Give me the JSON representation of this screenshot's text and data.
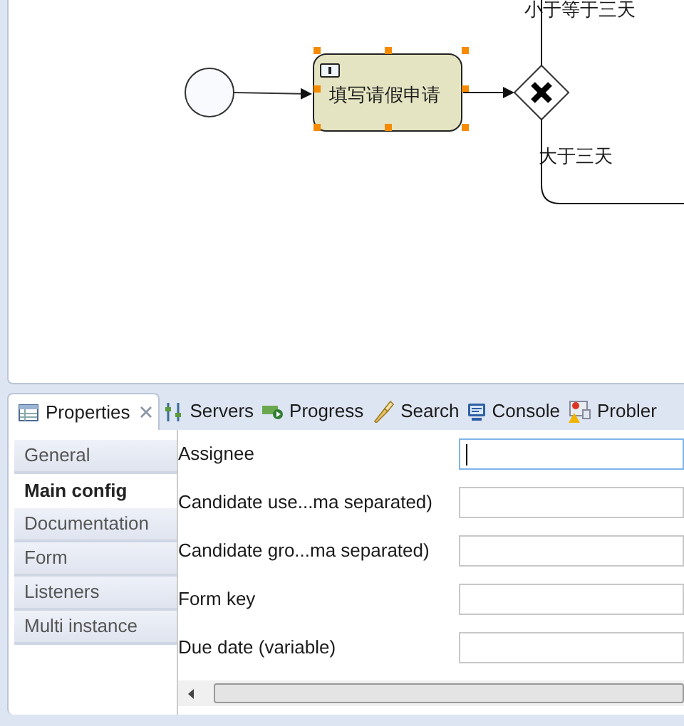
{
  "diagram": {
    "task": {
      "label": "填写请假申请",
      "selected": true
    },
    "flow_labels": [
      "小于等于三天",
      "大于三天"
    ]
  },
  "tabs": [
    {
      "label": "Properties",
      "selected": true,
      "closable": true
    },
    {
      "label": "Servers",
      "selected": false,
      "closable": false
    },
    {
      "label": "Progress",
      "selected": false,
      "closable": false
    },
    {
      "label": "Search",
      "selected": false,
      "closable": false
    },
    {
      "label": "Console",
      "selected": false,
      "closable": false
    },
    {
      "label": "Probler",
      "selected": false,
      "closable": false
    }
  ],
  "sections": [
    {
      "label": "General",
      "selected": false
    },
    {
      "label": "Main config",
      "selected": true
    },
    {
      "label": "Documentation",
      "selected": false
    },
    {
      "label": "Form",
      "selected": false
    },
    {
      "label": "Listeners",
      "selected": false
    },
    {
      "label": "Multi instance",
      "selected": false
    }
  ],
  "fields": [
    {
      "label": "Assignee",
      "focused": true
    },
    {
      "label": "Candidate use...ma separated)",
      "focused": false
    },
    {
      "label": "Candidate gro...ma separated)",
      "focused": false
    },
    {
      "label": "Form key",
      "focused": false
    },
    {
      "label": "Due date (variable)",
      "focused": false
    }
  ]
}
